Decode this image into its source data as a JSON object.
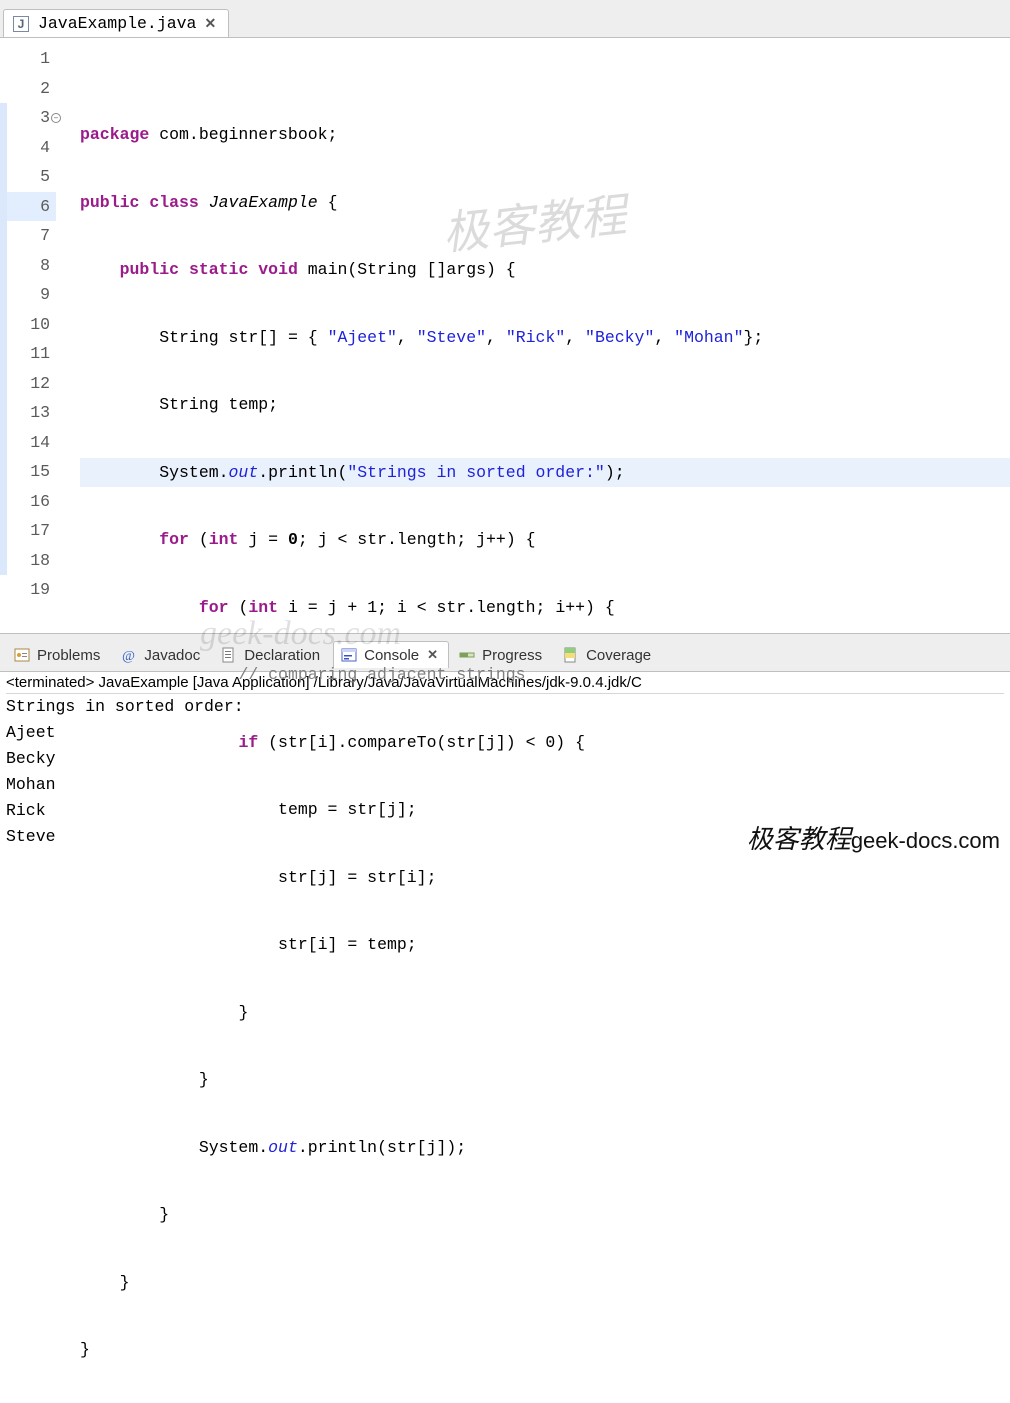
{
  "editor": {
    "file_tab": {
      "filename": "JavaExample.java"
    },
    "lines": [
      {
        "num": "1"
      },
      {
        "num": "2"
      },
      {
        "num": "3",
        "fold": true,
        "strip": true
      },
      {
        "num": "4"
      },
      {
        "num": "5"
      },
      {
        "num": "6",
        "highlight": true
      },
      {
        "num": "7"
      },
      {
        "num": "8"
      },
      {
        "num": "9"
      },
      {
        "num": "10"
      },
      {
        "num": "11"
      },
      {
        "num": "12"
      },
      {
        "num": "13"
      },
      {
        "num": "14"
      },
      {
        "num": "15"
      },
      {
        "num": "16"
      },
      {
        "num": "17"
      },
      {
        "num": "18",
        "strip": true
      },
      {
        "num": "19"
      }
    ],
    "tokens": {
      "kw_package": "package",
      "pkg": " com.beginnersbook;",
      "kw_public": "public",
      "kw_class": "class",
      "cls_name": " JavaExample ",
      "brace_open": "{",
      "kw_static": "static",
      "kw_void": "void",
      "main_sig": " main(String []args) {",
      "t_string": "String",
      "arr_decl": " str[] = { ",
      "s1": "\"Ajeet\"",
      "s2": "\"Steve\"",
      "s3": "\"Rick\"",
      "s4": "\"Becky\"",
      "s5": "\"Mohan\"",
      "arr_end": "};",
      "temp_decl": " temp;",
      "sys": "System.",
      "out": "out",
      "println": ".println(",
      "str_sorted": "\"Strings in sorted order:\"",
      "close_paren": ");",
      "kw_for": "for",
      "kw_int": "int",
      "for_j": " j = ",
      "zero": "0",
      "for_j2": "; j < str.length; j++) {",
      "for_i": " i = j + 1; i < str.length; i++) {",
      "cmt1": "// comparing adjacent strings",
      "kw_if": "if",
      "if_cond": " (str[i].compareTo(str[j]) < 0) {",
      "a1": "temp = str[j];",
      "a2": "str[j] = str[i];",
      "a3": "str[i] = temp;",
      "brace_close": "}",
      "println_j": ".println(str[j]);"
    }
  },
  "panel": {
    "tabs": {
      "problems": "Problems",
      "javadoc": "Javadoc",
      "declaration": "Declaration",
      "console": "Console",
      "progress": "Progress",
      "coverage": "Coverage"
    },
    "console": {
      "header": "<terminated> JavaExample [Java Application] /Library/Java/JavaVirtualMachines/jdk-9.0.4.jdk/C",
      "output": [
        "Strings in sorted order:",
        "Ajeet",
        "Becky",
        "Mohan",
        "Rick",
        "Steve"
      ]
    }
  },
  "watermark": {
    "cn": "极客教程",
    "en": "geek-docs.com",
    "geek": "geek-docs.com"
  }
}
